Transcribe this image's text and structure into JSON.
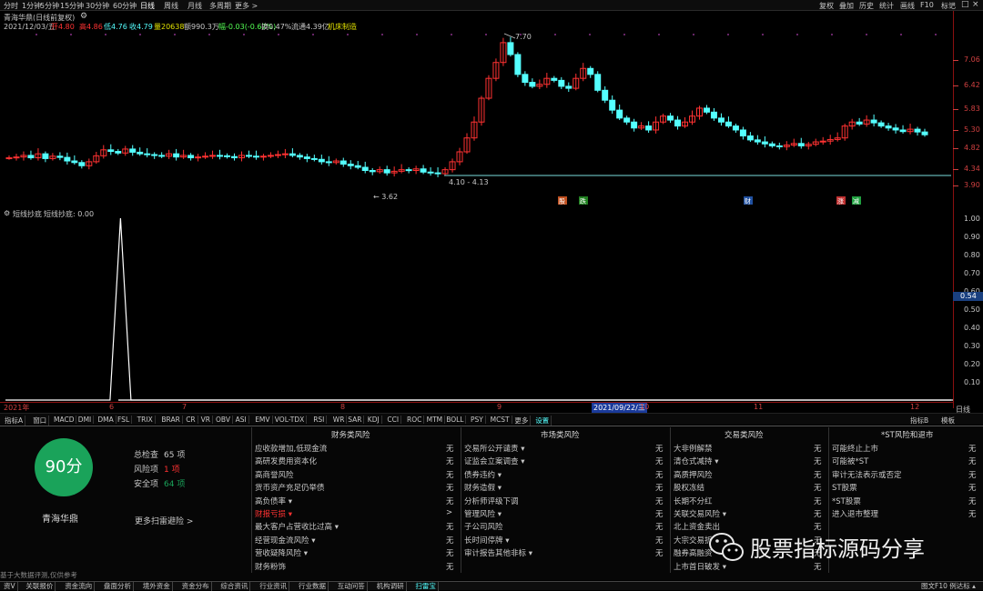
{
  "period_bar": {
    "items": [
      "分时",
      "1分钟",
      "5分钟",
      "15分钟",
      "30分钟",
      "60分钟",
      "日线",
      "周线",
      "月线",
      "多周期",
      "更多 >"
    ],
    "active": "日线"
  },
  "top_right": {
    "items": [
      "复权",
      "叠加",
      "历史",
      "统计",
      "画线",
      "F10",
      "标记"
    ]
  },
  "stock": {
    "title": "青海华鼎(日线前复权)",
    "date": "2021/12/03/五",
    "open": "开4.80",
    "high": "高4.86",
    "high2": "低4.76",
    "close": "收4.79",
    "volume": "量20638",
    "amount": "额990.3万",
    "change": "幅-0.03(-0.62%)",
    "turnover": "换0.47%",
    "float_cap": "流通4.39亿",
    "industry": "机床制造"
  },
  "price_axis": [
    "7.06",
    "6.42",
    "5.83",
    "5.30",
    "4.82",
    "4.34",
    "3.90"
  ],
  "annotations": {
    "peak": "7.70",
    "low": "3.62",
    "range": "4.10 - 4.13"
  },
  "flags": [
    "股",
    "跌",
    "财",
    "涨",
    "减"
  ],
  "osc_panel": {
    "title": "短线抄底",
    "line_label": "短线抄底: 0.00",
    "axis": [
      "1.00",
      "0.90",
      "0.80",
      "0.70",
      "0.60",
      "0.50",
      "0.40",
      "0.30",
      "0.20",
      "0.10"
    ],
    "current": "0.54"
  },
  "chart_data": {
    "type": "line",
    "series": [
      {
        "name": "短线抄底",
        "values": [
          0,
          0,
          0,
          0,
          0,
          0,
          0,
          0,
          0,
          0,
          0,
          1.0,
          0,
          0,
          0,
          0,
          0,
          0,
          0,
          0,
          0,
          0,
          0,
          0,
          0,
          0,
          0,
          0,
          0,
          0,
          0,
          0,
          0,
          0,
          0,
          0,
          0,
          0,
          0,
          0,
          0,
          0,
          0,
          0,
          0,
          0,
          0,
          0,
          0,
          0,
          0,
          0,
          0,
          0,
          0,
          0,
          0,
          0,
          0,
          0,
          0,
          0,
          0,
          0,
          0,
          0,
          0,
          0,
          0,
          0,
          0,
          0,
          0,
          0,
          0,
          0,
          0,
          0,
          0,
          0,
          0,
          0,
          0,
          0,
          0,
          0,
          0,
          0,
          0,
          0,
          0,
          0,
          0,
          0,
          0,
          0,
          0,
          0,
          0,
          0
        ]
      }
    ],
    "ylim": [
      0,
      1.0
    ]
  },
  "time_axis": [
    "2021年",
    "6",
    "7",
    "8",
    "9",
    "2021/09/22/三",
    "10",
    "11",
    "12"
  ],
  "time_axis_right": "日线",
  "indicator_tabs": [
    "指标A",
    "窗口",
    "MACD",
    "DMI",
    "DMA",
    "FSL",
    "TRIX",
    "BRAR",
    "CR",
    "VR",
    "OBV",
    "ASI",
    "EMV",
    "VOL-TDX",
    "RSI",
    "WR",
    "SAR",
    "KDJ",
    "CCI",
    "ROC",
    "MTM",
    "BOLL",
    "PSY",
    "MCST",
    "更多",
    "设置"
  ],
  "indicator_right": [
    "指标B",
    "模板"
  ],
  "risk": {
    "score": "90分",
    "name": "青海华鼎",
    "total_label": "总检查",
    "total": "65 项",
    "risk_label": "风险项",
    "risk": "1 项",
    "safe_label": "安全项",
    "safe": "64 项",
    "more": "更多扫雷避险 >",
    "footer": "基于大数据评测,仅供参考",
    "columns": [
      {
        "title": "财务类风险",
        "items": [
          {
            "label": "应收款增加,低现金流",
            "val": "无"
          },
          {
            "label": "高研发费用资本化",
            "val": "无"
          },
          {
            "label": "高商誉风险",
            "val": "无"
          },
          {
            "label": "货币资产充足仍举债",
            "val": "无"
          },
          {
            "label": "高负债率 ▾",
            "val": "无"
          },
          {
            "label": "财报亏损 ▾",
            "val": ">",
            "hot": true
          },
          {
            "label": "最大客户占营收比过高 ▾",
            "val": "无"
          },
          {
            "label": "经营现金流风险 ▾",
            "val": "无"
          },
          {
            "label": "营收疑降风险 ▾",
            "val": "无"
          },
          {
            "label": "财务粉饰",
            "val": "无"
          }
        ]
      },
      {
        "title": "市场类风险",
        "items": [
          {
            "label": "交易所公开谴责 ▾",
            "val": "无"
          },
          {
            "label": "证监会立案调查 ▾",
            "val": "无"
          },
          {
            "label": "债券违约 ▾",
            "val": "无"
          },
          {
            "label": "财务造假 ▾",
            "val": "无"
          },
          {
            "label": "分析师评级下调",
            "val": "无"
          },
          {
            "label": "管理风险 ▾",
            "val": "无"
          },
          {
            "label": "子公司风险",
            "val": "无"
          },
          {
            "label": "长时间停牌 ▾",
            "val": "无"
          },
          {
            "label": "审计报告其他非标 ▾",
            "val": "无"
          }
        ]
      },
      {
        "title": "交易类风险",
        "items": [
          {
            "label": "大非例解禁",
            "val": "无"
          },
          {
            "label": "清仓式减持 ▾",
            "val": "无"
          },
          {
            "label": "高质押风险",
            "val": "无"
          },
          {
            "label": "股权冻结",
            "val": "无"
          },
          {
            "label": "长期不分红",
            "val": "无"
          },
          {
            "label": "关联交易风险 ▾",
            "val": "无"
          },
          {
            "label": "北上资金卖出",
            "val": "无"
          },
          {
            "label": "大宗交易折",
            "val": "无"
          },
          {
            "label": "融券高融资",
            "val": "无"
          },
          {
            "label": "上市首日破发 ▾",
            "val": "无"
          }
        ]
      },
      {
        "title": "*ST风险和退市",
        "items": [
          {
            "label": "可能终止上市",
            "val": "无"
          },
          {
            "label": "可能被*ST",
            "val": "无"
          },
          {
            "label": "审计无法表示或否定",
            "val": "无"
          },
          {
            "label": "ST股票",
            "val": "无"
          },
          {
            "label": "*ST股票",
            "val": "无"
          },
          {
            "label": "进入退市整理",
            "val": "无"
          }
        ]
      }
    ]
  },
  "watermark": "股票指标源码分享",
  "bottom_nav": [
    "资Ⅴ",
    "关联报价",
    "资金流向",
    "盘面分析",
    "境外资金",
    "资金分布",
    "综合资讯",
    "行业资讯",
    "行业数据",
    "互动问答",
    "机构调研",
    "扫雷宝"
  ],
  "bottom_right": "图文F10 例达标 ▴",
  "colors": {
    "up": "#ff3232",
    "down": "#54ffff",
    "axis": "#d04040",
    "score": "#1aa35a"
  }
}
